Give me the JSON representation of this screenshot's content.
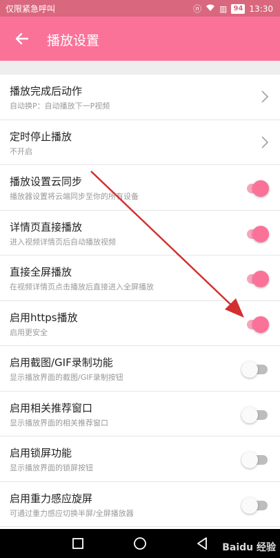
{
  "status_bar": {
    "carrier": "仅限紧急呼叫",
    "battery": "94",
    "time": "13:30"
  },
  "app_bar": {
    "title": "播放设置"
  },
  "settings": [
    {
      "title": "播放完成后动作",
      "subtitle": "自动换P：自动播放下一P视频",
      "control": "chevron"
    },
    {
      "title": "定时停止播放",
      "subtitle": "不开启",
      "control": "chevron"
    },
    {
      "title": "播放设置云同步",
      "subtitle": "播放器设置将云端同步至你的所有设备",
      "control": "toggle",
      "enabled": true
    },
    {
      "title": "详情页直接播放",
      "subtitle": "进入视频详情页后自动播放视频",
      "control": "toggle",
      "enabled": true
    },
    {
      "title": "直接全屏播放",
      "subtitle": "在视频详情页点击播放后直接进入全屏播放",
      "control": "toggle",
      "enabled": true
    },
    {
      "title": "启用https播放",
      "subtitle": "启用更安全",
      "control": "toggle",
      "enabled": true
    },
    {
      "title": "启用截图/GIF录制功能",
      "subtitle": "显示播放界面的截图/GIF录制按钮",
      "control": "toggle",
      "enabled": false
    },
    {
      "title": "启用相关推荐窗口",
      "subtitle": "显示播放界面的相关推荐窗口",
      "control": "toggle",
      "enabled": false
    },
    {
      "title": "启用锁屏功能",
      "subtitle": "显示播放界面的锁屏按钮",
      "control": "toggle",
      "enabled": false
    },
    {
      "title": "启用重力感应旋屏",
      "subtitle": "可通过重力感应切换半屏/全屏播放器",
      "control": "toggle",
      "enabled": false
    }
  ],
  "colors": {
    "accent": "#fb7299",
    "status_bar": "#d9687e",
    "annotation_arrow": "#d32f2f"
  },
  "watermark": "Baidu 经验"
}
